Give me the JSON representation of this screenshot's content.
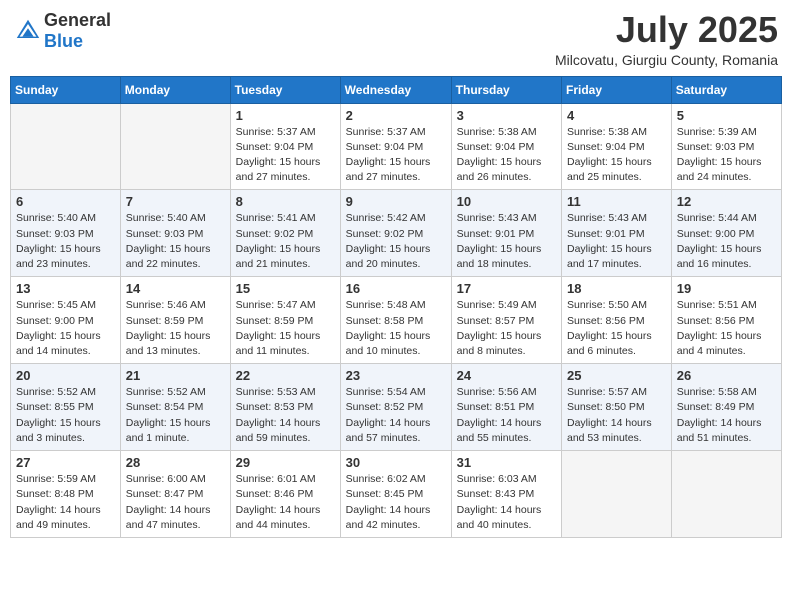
{
  "logo": {
    "general": "General",
    "blue": "Blue"
  },
  "title": "July 2025",
  "location": "Milcovatu, Giurgiu County, Romania",
  "days_of_week": [
    "Sunday",
    "Monday",
    "Tuesday",
    "Wednesday",
    "Thursday",
    "Friday",
    "Saturday"
  ],
  "weeks": [
    [
      {
        "day": "",
        "empty": true
      },
      {
        "day": "",
        "empty": true
      },
      {
        "day": "1",
        "sunrise": "Sunrise: 5:37 AM",
        "sunset": "Sunset: 9:04 PM",
        "daylight": "Daylight: 15 hours and 27 minutes."
      },
      {
        "day": "2",
        "sunrise": "Sunrise: 5:37 AM",
        "sunset": "Sunset: 9:04 PM",
        "daylight": "Daylight: 15 hours and 27 minutes."
      },
      {
        "day": "3",
        "sunrise": "Sunrise: 5:38 AM",
        "sunset": "Sunset: 9:04 PM",
        "daylight": "Daylight: 15 hours and 26 minutes."
      },
      {
        "day": "4",
        "sunrise": "Sunrise: 5:38 AM",
        "sunset": "Sunset: 9:04 PM",
        "daylight": "Daylight: 15 hours and 25 minutes."
      },
      {
        "day": "5",
        "sunrise": "Sunrise: 5:39 AM",
        "sunset": "Sunset: 9:03 PM",
        "daylight": "Daylight: 15 hours and 24 minutes."
      }
    ],
    [
      {
        "day": "6",
        "sunrise": "Sunrise: 5:40 AM",
        "sunset": "Sunset: 9:03 PM",
        "daylight": "Daylight: 15 hours and 23 minutes."
      },
      {
        "day": "7",
        "sunrise": "Sunrise: 5:40 AM",
        "sunset": "Sunset: 9:03 PM",
        "daylight": "Daylight: 15 hours and 22 minutes."
      },
      {
        "day": "8",
        "sunrise": "Sunrise: 5:41 AM",
        "sunset": "Sunset: 9:02 PM",
        "daylight": "Daylight: 15 hours and 21 minutes."
      },
      {
        "day": "9",
        "sunrise": "Sunrise: 5:42 AM",
        "sunset": "Sunset: 9:02 PM",
        "daylight": "Daylight: 15 hours and 20 minutes."
      },
      {
        "day": "10",
        "sunrise": "Sunrise: 5:43 AM",
        "sunset": "Sunset: 9:01 PM",
        "daylight": "Daylight: 15 hours and 18 minutes."
      },
      {
        "day": "11",
        "sunrise": "Sunrise: 5:43 AM",
        "sunset": "Sunset: 9:01 PM",
        "daylight": "Daylight: 15 hours and 17 minutes."
      },
      {
        "day": "12",
        "sunrise": "Sunrise: 5:44 AM",
        "sunset": "Sunset: 9:00 PM",
        "daylight": "Daylight: 15 hours and 16 minutes."
      }
    ],
    [
      {
        "day": "13",
        "sunrise": "Sunrise: 5:45 AM",
        "sunset": "Sunset: 9:00 PM",
        "daylight": "Daylight: 15 hours and 14 minutes."
      },
      {
        "day": "14",
        "sunrise": "Sunrise: 5:46 AM",
        "sunset": "Sunset: 8:59 PM",
        "daylight": "Daylight: 15 hours and 13 minutes."
      },
      {
        "day": "15",
        "sunrise": "Sunrise: 5:47 AM",
        "sunset": "Sunset: 8:59 PM",
        "daylight": "Daylight: 15 hours and 11 minutes."
      },
      {
        "day": "16",
        "sunrise": "Sunrise: 5:48 AM",
        "sunset": "Sunset: 8:58 PM",
        "daylight": "Daylight: 15 hours and 10 minutes."
      },
      {
        "day": "17",
        "sunrise": "Sunrise: 5:49 AM",
        "sunset": "Sunset: 8:57 PM",
        "daylight": "Daylight: 15 hours and 8 minutes."
      },
      {
        "day": "18",
        "sunrise": "Sunrise: 5:50 AM",
        "sunset": "Sunset: 8:56 PM",
        "daylight": "Daylight: 15 hours and 6 minutes."
      },
      {
        "day": "19",
        "sunrise": "Sunrise: 5:51 AM",
        "sunset": "Sunset: 8:56 PM",
        "daylight": "Daylight: 15 hours and 4 minutes."
      }
    ],
    [
      {
        "day": "20",
        "sunrise": "Sunrise: 5:52 AM",
        "sunset": "Sunset: 8:55 PM",
        "daylight": "Daylight: 15 hours and 3 minutes."
      },
      {
        "day": "21",
        "sunrise": "Sunrise: 5:52 AM",
        "sunset": "Sunset: 8:54 PM",
        "daylight": "Daylight: 15 hours and 1 minute."
      },
      {
        "day": "22",
        "sunrise": "Sunrise: 5:53 AM",
        "sunset": "Sunset: 8:53 PM",
        "daylight": "Daylight: 14 hours and 59 minutes."
      },
      {
        "day": "23",
        "sunrise": "Sunrise: 5:54 AM",
        "sunset": "Sunset: 8:52 PM",
        "daylight": "Daylight: 14 hours and 57 minutes."
      },
      {
        "day": "24",
        "sunrise": "Sunrise: 5:56 AM",
        "sunset": "Sunset: 8:51 PM",
        "daylight": "Daylight: 14 hours and 55 minutes."
      },
      {
        "day": "25",
        "sunrise": "Sunrise: 5:57 AM",
        "sunset": "Sunset: 8:50 PM",
        "daylight": "Daylight: 14 hours and 53 minutes."
      },
      {
        "day": "26",
        "sunrise": "Sunrise: 5:58 AM",
        "sunset": "Sunset: 8:49 PM",
        "daylight": "Daylight: 14 hours and 51 minutes."
      }
    ],
    [
      {
        "day": "27",
        "sunrise": "Sunrise: 5:59 AM",
        "sunset": "Sunset: 8:48 PM",
        "daylight": "Daylight: 14 hours and 49 minutes."
      },
      {
        "day": "28",
        "sunrise": "Sunrise: 6:00 AM",
        "sunset": "Sunset: 8:47 PM",
        "daylight": "Daylight: 14 hours and 47 minutes."
      },
      {
        "day": "29",
        "sunrise": "Sunrise: 6:01 AM",
        "sunset": "Sunset: 8:46 PM",
        "daylight": "Daylight: 14 hours and 44 minutes."
      },
      {
        "day": "30",
        "sunrise": "Sunrise: 6:02 AM",
        "sunset": "Sunset: 8:45 PM",
        "daylight": "Daylight: 14 hours and 42 minutes."
      },
      {
        "day": "31",
        "sunrise": "Sunrise: 6:03 AM",
        "sunset": "Sunset: 8:43 PM",
        "daylight": "Daylight: 14 hours and 40 minutes."
      },
      {
        "day": "",
        "empty": true
      },
      {
        "day": "",
        "empty": true
      }
    ]
  ]
}
